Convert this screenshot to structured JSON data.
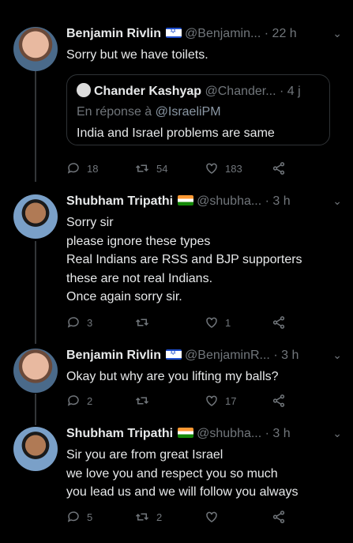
{
  "tweets": [
    {
      "name": "Benjamin Rivlin",
      "handle": "@Benjamin...",
      "time": "· 22 h",
      "lines": [
        "Sorry but we have toilets."
      ],
      "quote": {
        "name": "Chander Kashyap",
        "handle": "@Chander...",
        "time": "· 4 j",
        "reply_prefix": "En réponse à ",
        "reply_to": "@IsraeliPM",
        "text": "India and Israel problems are same"
      },
      "replies": "18",
      "retweets": "54",
      "likes": "183"
    },
    {
      "name": "Shubham Tripathi",
      "handle": "@shubha...",
      "time": "· 3 h",
      "lines": [
        "Sorry sir",
        "please ignore these types",
        "Real Indians are RSS and BJP supporters",
        "these are not real Indians.",
        "Once again sorry sir."
      ],
      "replies": "3",
      "retweets": "",
      "likes": "1"
    },
    {
      "name": "Benjamin Rivlin",
      "handle": "@BenjaminR...",
      "time": "· 3 h",
      "lines": [
        "Okay but why are you lifting my balls?"
      ],
      "replies": "2",
      "retweets": "",
      "likes": "17"
    },
    {
      "name": "Shubham Tripathi",
      "handle": "@shubha...",
      "time": "· 3 h",
      "lines": [
        "Sir you are from great Israel",
        "we love you and respect you so much",
        "you lead us and we will follow you always"
      ],
      "replies": "5",
      "retweets": "2",
      "likes": ""
    }
  ]
}
